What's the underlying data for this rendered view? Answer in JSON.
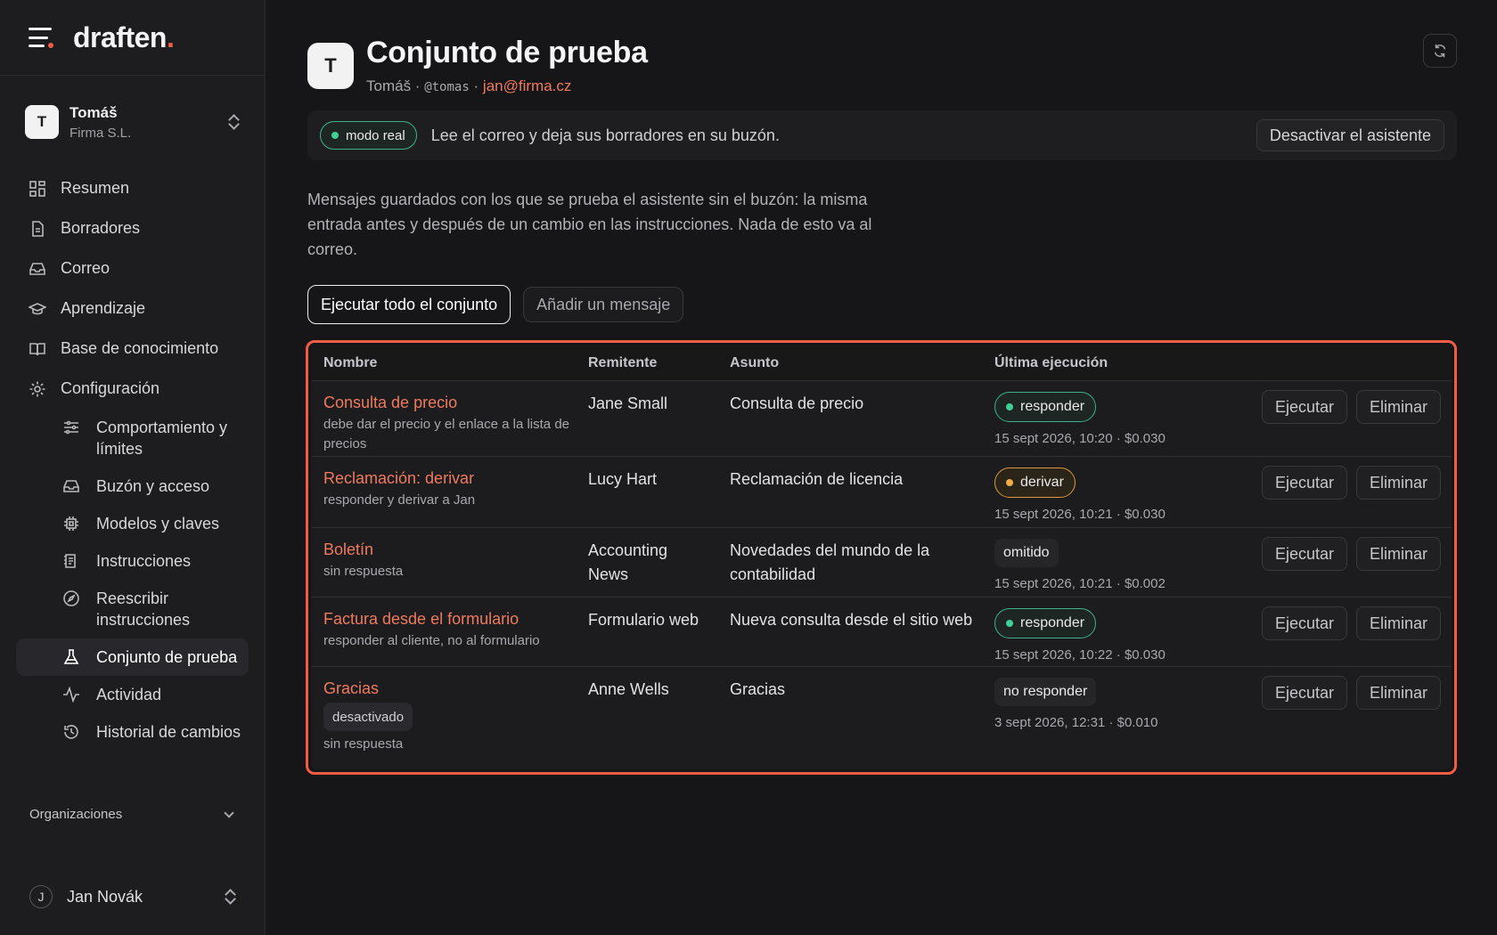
{
  "brand": {
    "name": "draften",
    "dot": "."
  },
  "account": {
    "initial": "T",
    "name": "Tomáš",
    "org": "Firma S.L."
  },
  "nav": [
    {
      "label": "Resumen",
      "icon": "grid-icon"
    },
    {
      "label": "Borradores",
      "icon": "document-icon"
    },
    {
      "label": "Correo",
      "icon": "inbox-icon"
    },
    {
      "label": "Aprendizaje",
      "icon": "graduation-cap-icon"
    },
    {
      "label": "Base de conocimiento",
      "icon": "book-icon"
    },
    {
      "label": "Configuración",
      "icon": "gear-icon"
    }
  ],
  "subnav": [
    {
      "label": "Comportamiento y límites",
      "icon": "sliders-icon"
    },
    {
      "label": "Buzón y acceso",
      "icon": "inbox-icon"
    },
    {
      "label": "Modelos y claves",
      "icon": "chip-icon"
    },
    {
      "label": "Instrucciones",
      "icon": "instructions-icon"
    },
    {
      "label": "Reescribir instrucciones",
      "icon": "compass-icon"
    },
    {
      "label": "Conjunto de prueba",
      "icon": "flask-icon",
      "active": true
    },
    {
      "label": "Actividad",
      "icon": "activity-icon"
    },
    {
      "label": "Historial de cambios",
      "icon": "history-icon"
    }
  ],
  "orgs_label": "Organizaciones",
  "user": {
    "initial": "J",
    "name": "Jan Novák"
  },
  "header": {
    "initial": "T",
    "title": "Conjunto de prueba",
    "owner": "Tomáš ·",
    "handle": "@tomas",
    "sep": "·",
    "email": "jan@firma.cz"
  },
  "banner": {
    "mode": "modo real",
    "text": "Lee el correo y deja sus borradores en su buzón.",
    "button": "Desactivar el asistente"
  },
  "description": "Mensajes guardados con los que se prueba el asistente sin el buzón: la misma entrada antes y después de un cambio en las instrucciones. Nada de esto va al correo.",
  "actions": {
    "run_all": "Ejecutar todo el conjunto",
    "add": "Añadir un mensaje"
  },
  "table": {
    "columns": [
      "Nombre",
      "Remitente",
      "Asunto",
      "Última ejecución"
    ],
    "run_label": "Ejecutar",
    "delete_label": "Eliminar",
    "rows": [
      {
        "name": "Consulta de precio",
        "desc": "debe dar el precio y el enlace a la lista de precios",
        "tag": "",
        "from": "Jane Small",
        "subject": "Consulta de precio",
        "status": "responder",
        "status_style": "green",
        "meta": "15 sept 2026, 10:20 · $0.030"
      },
      {
        "name": "Reclamación: derivar",
        "desc": "responder y derivar a Jan",
        "tag": "",
        "from": "Lucy Hart",
        "subject": "Reclamación de licencia",
        "status": "derivar",
        "status_style": "amber",
        "meta": "15 sept 2026, 10:21 · $0.030"
      },
      {
        "name": "Boletín",
        "desc": "sin respuesta",
        "tag": "",
        "from": "Accounting News",
        "subject": "Novedades del mundo de la contabilidad",
        "status": "omitido",
        "status_style": "plain",
        "meta": "15 sept 2026, 10:21 · $0.002"
      },
      {
        "name": "Factura desde el formulario",
        "desc": "responder al cliente, no al formulario",
        "tag": "",
        "from": "Formulario web",
        "subject": "Nueva consulta desde el sitio web",
        "status": "responder",
        "status_style": "green",
        "meta": "15 sept 2026, 10:22 · $0.030"
      },
      {
        "name": "Gracias",
        "desc": "sin respuesta",
        "tag": "desactivado",
        "from": "Anne Wells",
        "subject": "Gracias",
        "status": "no responder",
        "status_style": "plain",
        "meta": "3 sept 2026, 12:31 · $0.010"
      }
    ]
  },
  "colors": {
    "accent": "#ef5d44",
    "link": "#ef7a5e",
    "green": "#3fcf98",
    "amber": "#f0ad4a",
    "bg": "#161618"
  }
}
